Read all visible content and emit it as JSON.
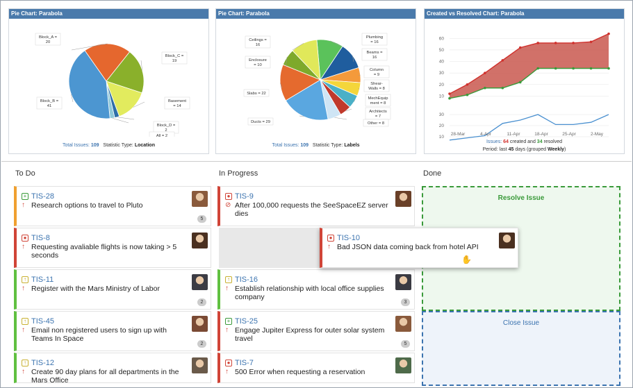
{
  "gadgets": [
    {
      "title": "Pie Chart: Parabola",
      "total_label": "Total Issues:",
      "total_value": "109",
      "stat_label": "Statistic Type:",
      "stat_value": "Location",
      "labels": [
        "Block_A = 20",
        "Block_C = 19",
        "Block_B = 41",
        "Basement = 14",
        "Block_D = 2",
        "All = 2"
      ]
    },
    {
      "title": "Pie Chart: Parabola",
      "total_label": "Total Issues:",
      "total_value": "109",
      "stat_label": "Statistic Type:",
      "stat_value": "Labels",
      "labels": [
        "Plumbing = 16",
        "Ceilings = 16",
        "Beams = 16",
        "Enclosure = 10",
        "Column = 9",
        "Sheer-Walls = 8",
        "Slabs = 22",
        "MechEquipment = 8",
        "Architects = 7",
        "Ducts = 29",
        "Other = 8"
      ]
    },
    {
      "title": "Created vs Resolved Chart: Parabola",
      "legend_prefix": "Issues:",
      "created_value": "64",
      "legend_mid": "created and",
      "resolved_value": "34",
      "legend_suffix": "resolved",
      "period_prefix": "Period: last",
      "period_days": "45",
      "period_mid": "days (grouped",
      "period_group": "Weekly",
      "period_end": ")"
    }
  ],
  "chart_data": [
    {
      "type": "pie",
      "title": "Pie Chart: Parabola",
      "slices": [
        {
          "name": "Block_A",
          "value": 20,
          "color": "#e5672e"
        },
        {
          "name": "Block_C",
          "value": 19,
          "color": "#8ab02b"
        },
        {
          "name": "Basement",
          "value": 14,
          "color": "#e2eb5e"
        },
        {
          "name": "Block_D",
          "value": 2,
          "color": "#2e6fa8"
        },
        {
          "name": "All",
          "value": 2,
          "color": "#8fc9d9"
        },
        {
          "name": "Block_B",
          "value": 41,
          "color": "#4c96d1"
        }
      ]
    },
    {
      "type": "pie",
      "title": "Pie Chart: Parabola",
      "slices": [
        {
          "name": "Plumbing",
          "value": 16,
          "color": "#5bc25b"
        },
        {
          "name": "Beams",
          "value": 16,
          "color": "#1f5d9e"
        },
        {
          "name": "Column",
          "value": 9,
          "color": "#f49a3b"
        },
        {
          "name": "Sheer-Walls",
          "value": 8,
          "color": "#f4d63b"
        },
        {
          "name": "MechEquipment",
          "value": 8,
          "color": "#4ab0c7"
        },
        {
          "name": "Architects",
          "value": 7,
          "color": "#c0392b"
        },
        {
          "name": "Other",
          "value": 8,
          "color": "#cfe5f5"
        },
        {
          "name": "Ducts",
          "value": 29,
          "color": "#5aa7e0"
        },
        {
          "name": "Slabs",
          "value": 22,
          "color": "#e56a2e"
        },
        {
          "name": "Enclosure",
          "value": 10,
          "color": "#7ea92b"
        },
        {
          "name": "Ceilings",
          "value": 16,
          "color": "#e0e85a"
        }
      ]
    },
    {
      "type": "line",
      "title": "Created vs Resolved Chart: Parabola",
      "categories": [
        "28-Mar",
        "4-Apr",
        "11-Apr",
        "18-Apr",
        "25-Apr",
        "2-May"
      ],
      "top": {
        "ylim": [
          0,
          65
        ],
        "yticks": [
          10,
          20,
          30,
          40,
          50,
          60
        ],
        "x": [
          0,
          1,
          2,
          3,
          4,
          5,
          6,
          7,
          8,
          9
        ],
        "series": [
          {
            "name": "created",
            "color": "#d0312d",
            "values": [
              12,
              20,
              30,
              41,
              52,
              56,
              56,
              56,
              57,
              64
            ]
          },
          {
            "name": "resolved",
            "color": "#3a9a3a",
            "values": [
              8,
              11,
              17,
              17,
              22,
              34,
              34,
              34,
              34,
              34
            ]
          }
        ]
      },
      "bottom": {
        "ylim": [
          5,
          35
        ],
        "yticks": [
          10,
          20,
          30
        ],
        "x": [
          0,
          1,
          2,
          3,
          4,
          5,
          6,
          7,
          8,
          9
        ],
        "series": [
          {
            "name": "unresolved trend",
            "color": "#4a90d0",
            "values": [
              7,
              9,
              11,
              22,
              25,
              30,
              21,
              21,
              23,
              30
            ]
          }
        ]
      }
    }
  ],
  "board": {
    "columns": [
      "To Do",
      "In Progress",
      "Done"
    ],
    "todo": [
      {
        "key": "TIS-28",
        "summary": "Research options to travel to Pluto",
        "type": "new-feature",
        "badge": "5",
        "bar": "#f0a030",
        "avatar": "#8a5a3c"
      },
      {
        "key": "TIS-8",
        "summary": "Requesting avaliable flights is now taking > 5 seconds",
        "type": "bug",
        "badge": "",
        "bar": "#d04437",
        "avatar": "#4a3020"
      },
      {
        "key": "TIS-11",
        "summary": "Register with the Mars Ministry of Labor",
        "type": "improvement",
        "badge": "2",
        "bar": "#60c040",
        "avatar": "#3c3c44"
      },
      {
        "key": "TIS-45",
        "summary": "Email non registered users to sign up with Teams In Space",
        "type": "improvement",
        "badge": "2",
        "bar": "#60c040",
        "avatar": "#7a4a34"
      },
      {
        "key": "TIS-12",
        "summary": "Create 90 day plans for all departments in the Mars Office",
        "type": "improvement",
        "badge": "",
        "bar": "#60c040",
        "avatar": "#6a5a4a"
      }
    ],
    "inprogress": [
      {
        "key": "TIS-9",
        "summary": "After 100,000 requests the SeeSpaceEZ server dies",
        "type": "bug",
        "badge": "",
        "bar": "#d04437",
        "avatar": "#6a4028"
      },
      {
        "key": "TIS-16",
        "summary": "Establish relationship with local office supplies company",
        "type": "improvement",
        "badge": "3",
        "bar": "#60c040",
        "avatar": "#3a3a42"
      },
      {
        "key": "TIS-25",
        "summary": "Engage Jupiter Express for outer solar system travel",
        "type": "new-feature",
        "badge": "5",
        "bar": "#d04437",
        "avatar": "#8a5a3c"
      },
      {
        "key": "TIS-7",
        "summary": "500 Error when requesting a reservation",
        "type": "bug",
        "badge": "",
        "bar": "#d04437",
        "avatar": "#4e6a4a"
      }
    ],
    "dragging": {
      "key": "TIS-10",
      "summary": "Bad JSON data coming back from hotel API",
      "type": "bug",
      "bar": "#d04437",
      "avatar": "#4a3020"
    },
    "dropzones": [
      {
        "label": "Resolve Issue",
        "color": "#3a9a3a",
        "bg": "#eef8ee"
      },
      {
        "label": "Close Issue",
        "color": "#3b73af",
        "bg": "#eef3fa"
      }
    ]
  }
}
